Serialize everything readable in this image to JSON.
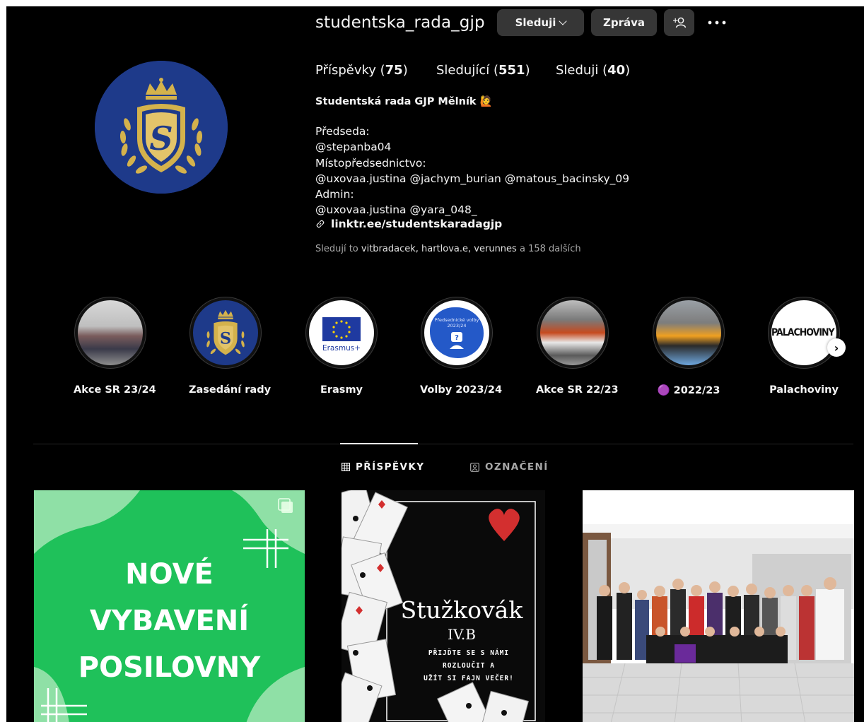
{
  "profile": {
    "username": "studentska_rada_gjp",
    "buttons": {
      "follow": "Sleduji",
      "message": "Zpráva",
      "add_icon": "+person-icon",
      "more_icon": "more-icon"
    },
    "stats": {
      "posts_label": "Příspěvky",
      "posts_count": "75",
      "followers_label": "Sledující",
      "followers_count": "551",
      "following_label": "Sleduji",
      "following_count": "40"
    },
    "display_name": "Studentská rada GJP Mělník 🙋",
    "bio_lines": [
      "Předseda:",
      "@stepanba04",
      "Místopředsednictvo:",
      "@uxovaa.justina @jachym_burian @matous_bacinsky_09",
      "Admin:",
      "@uxovaa.justina @yara_048_"
    ],
    "link": "linktr.ee/studentskaradagjp",
    "followed_by": {
      "prefix": "Sledují to",
      "names": "vitbradacek, hartlova.e, verunnes",
      "suffix": "a 158 dalších"
    }
  },
  "highlights": [
    {
      "label": "Akce SR 23/24"
    },
    {
      "label": "Zasedání rady"
    },
    {
      "label": "Erasmy",
      "logo_text": "Erasmus+"
    },
    {
      "label": "Volby 2023/24",
      "cover_text": "Předsednické volby 2023/24"
    },
    {
      "label": "Akce SR 22/23"
    },
    {
      "label": "🟣 2022/23"
    },
    {
      "label": "Palachoviny",
      "cover_text": "PALACHOVINY"
    }
  ],
  "tabs": {
    "posts": "PŘÍSPĚVKY",
    "tagged": "OZNAČENÍ"
  },
  "posts": [
    {
      "lines": [
        "NOVÉ",
        "VYBAVENÍ",
        "POSILOVNY"
      ]
    },
    {
      "title": "Stužkovák",
      "class": "IV.B",
      "subtitle_lines": [
        "PŘIJĎTE SE S NÁMI ROZLOUČIT A",
        "UŽÍT SI FAJN VEČER!"
      ]
    },
    {
      "type": "photo"
    }
  ],
  "colors": {
    "background": "#000000",
    "button": "#363636",
    "muted": "#a8a8a8",
    "post1_green": "#1fc15a",
    "avatar_blue": "#1e3a8a",
    "gold": "#d4b24c"
  }
}
